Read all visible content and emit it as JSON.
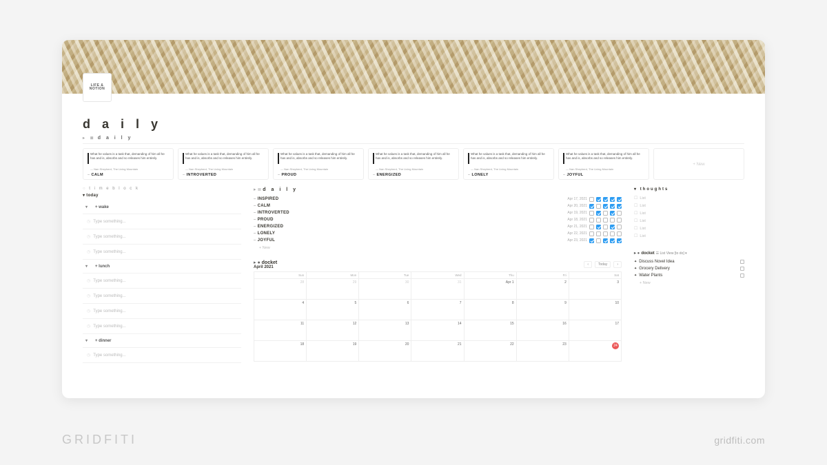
{
  "branding": {
    "left": "GRIDFITI",
    "right": "gridfiti.com"
  },
  "icon_label": "LIFE & NOTION",
  "title": "d a i l y",
  "gallery": {
    "heading": "d a i l y",
    "quote_text": "What he values is a task that, demanding of him all he has and is, absorbs and so releases him entirely.",
    "attribution": "— Nan Shepherd, The Living Mountain",
    "cards": [
      "CALM",
      "INTROVERTED",
      "PROUD",
      "ENERGIZED",
      "LONELY",
      "JOYFUL"
    ],
    "new_label": "+ New"
  },
  "timeblock": {
    "heading": "t i m e b l o c k",
    "today": "today",
    "placeholder": "Type something...",
    "sections": [
      {
        "label": "+ wake",
        "rows": 3
      },
      {
        "label": "+ lunch",
        "rows": 4
      },
      {
        "label": "+ dinner",
        "rows": 1
      }
    ]
  },
  "daily_list": {
    "heading": "d a i l y",
    "rows": [
      {
        "name": "INSPIRED",
        "date": "Apr 17, 2021",
        "checks": [
          false,
          true,
          true,
          true,
          true
        ]
      },
      {
        "name": "CALM",
        "date": "Apr 20, 2021",
        "checks": [
          true,
          false,
          true,
          true,
          true
        ]
      },
      {
        "name": "INTROVERTED",
        "date": "Apr 19, 2021",
        "checks": [
          false,
          true,
          false,
          true,
          false
        ]
      },
      {
        "name": "PROUD",
        "date": "Apr 18, 2021",
        "checks": [
          false,
          false,
          false,
          false,
          false
        ]
      },
      {
        "name": "ENERGIZED",
        "date": "Apr 21, 2021",
        "checks": [
          false,
          true,
          false,
          true,
          false
        ]
      },
      {
        "name": "LONELY",
        "date": "Apr 22, 2021",
        "checks": [
          false,
          false,
          false,
          false,
          false
        ]
      },
      {
        "name": "JOYFUL",
        "date": "Apr 23, 2021",
        "checks": [
          true,
          false,
          true,
          true,
          true
        ]
      }
    ],
    "new_label": "+ New"
  },
  "calendar": {
    "heading": "docket",
    "month": "April 2021",
    "today_btn": "Today",
    "dow": [
      "Sun",
      "Mon",
      "Tue",
      "Wed",
      "Thu",
      "Fri",
      "Sat"
    ],
    "cells": [
      {
        "n": "28",
        "dim": true
      },
      {
        "n": "29",
        "dim": true
      },
      {
        "n": "30",
        "dim": true
      },
      {
        "n": "31",
        "dim": true
      },
      {
        "n": "Apr 1"
      },
      {
        "n": "2"
      },
      {
        "n": "3"
      },
      {
        "n": "4"
      },
      {
        "n": "5"
      },
      {
        "n": "6"
      },
      {
        "n": "7"
      },
      {
        "n": "8"
      },
      {
        "n": "9"
      },
      {
        "n": "10"
      },
      {
        "n": "11"
      },
      {
        "n": "12"
      },
      {
        "n": "13"
      },
      {
        "n": "14"
      },
      {
        "n": "15"
      },
      {
        "n": "16"
      },
      {
        "n": "17"
      },
      {
        "n": "18"
      },
      {
        "n": "19"
      },
      {
        "n": "20"
      },
      {
        "n": "21"
      },
      {
        "n": "22"
      },
      {
        "n": "23"
      },
      {
        "n": "24",
        "today": true
      }
    ]
  },
  "thoughts": {
    "heading": "thoughts",
    "placeholder": "List",
    "count": 6
  },
  "docket_list": {
    "heading": "docket",
    "view": "☰ List View [to do] ▾",
    "items": [
      "Discuss Novel Idea",
      "Grocery Delivery",
      "Water Plants"
    ],
    "new_label": "+ New"
  }
}
